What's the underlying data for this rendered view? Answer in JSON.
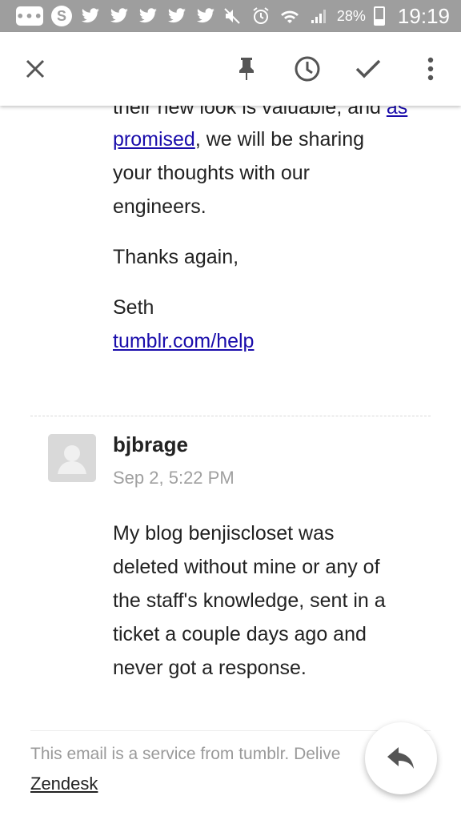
{
  "status_bar": {
    "notifications": [
      "messages-icon",
      "skype-icon",
      "twitter-icon",
      "twitter-icon",
      "twitter-icon",
      "twitter-icon",
      "twitter-icon"
    ],
    "battery_percent": "28%",
    "time": "19:19"
  },
  "toolbar": {
    "close_icon": "close-icon",
    "pin_icon": "pin-icon",
    "snooze_icon": "clock-icon",
    "done_icon": "check-icon",
    "more_icon": "more-vert-icon"
  },
  "message1": {
    "line0_text": "their new look is valuable, and ",
    "line0_link": "as",
    "line1_link": "promised",
    "line1_text": ", we will be sharing",
    "line2": "your thoughts with our",
    "line3": "engineers.",
    "thanks": "Thanks again,",
    "signature": "Seth",
    "help_link": "tumblr.com/help"
  },
  "message2": {
    "author": "bjbrage",
    "date": "Sep 2, 5:22 PM",
    "body_lines": [
      "My blog benjiscloset was",
      "deleted without mine or any of",
      "the staff's knowledge, sent in a",
      "ticket a couple days ago and",
      "never got a response."
    ]
  },
  "footer": {
    "text": "This email is a service from tumblr. Delive",
    "link": "Zendesk"
  },
  "colors": {
    "link": "#1a0dab",
    "status_bar": "#9e9e9e",
    "muted": "#a0a0a0"
  }
}
